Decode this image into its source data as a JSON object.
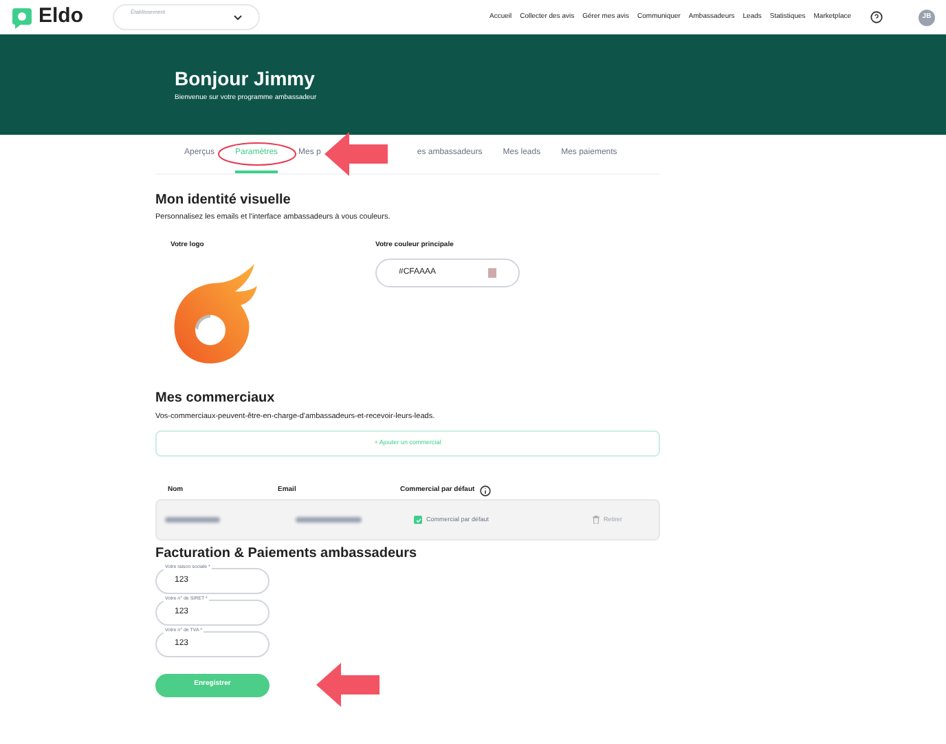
{
  "header": {
    "brand": "Eldo",
    "establishment_label": "Établissement",
    "nav": [
      "Accueil",
      "Collecter des avis",
      "Gérer mes avis",
      "Communiquer",
      "Ambassadeurs",
      "Leads",
      "Statistiques",
      "Marketplace"
    ],
    "avatar": "JB"
  },
  "banner": {
    "title": "Bonjour Jimmy",
    "subtitle": "Bienvenue sur votre programme ambassadeur"
  },
  "tabs": [
    {
      "label": "Aperçus",
      "selected": false
    },
    {
      "label": "Paramètres",
      "selected": true
    },
    {
      "label": "Mes p",
      "selected": false
    },
    {
      "label": "es ambassadeurs",
      "selected": false
    },
    {
      "label": "Mes leads",
      "selected": false
    },
    {
      "label": "Mes paiements",
      "selected": false
    }
  ],
  "identity": {
    "title": "Mon identité visuelle",
    "description": "Personnalisez les emails et l'interface ambassadeurs à vous couleurs.",
    "logo_label": "Votre logo",
    "color_label": "Votre couleur principale",
    "color_value": "#CFAAAA",
    "color": "#cfaaaa"
  },
  "sales": {
    "title": "Mes commerciaux",
    "description": "Vos-commerciaux-peuvent-être-en-charge-d'ambassadeurs-et-recevoir-leurs-leads.",
    "add_button": "+ Ajouter un commercial",
    "columns": [
      "Nom",
      "Email",
      "Commercial par défaut"
    ],
    "rows": [
      {
        "default_label": "Commercial par défaut",
        "checked": true,
        "remove": "Retirer"
      }
    ]
  },
  "billing": {
    "title": "Facturation & Paiements ambassadeurs",
    "fields": [
      {
        "label": "Votre raison sociale *",
        "value": "123"
      },
      {
        "label": "Votre n° de SIRET *",
        "value": "123"
      },
      {
        "label": "Votre n° de TVA *",
        "value": "123"
      }
    ],
    "submit": "Enregistrer"
  }
}
